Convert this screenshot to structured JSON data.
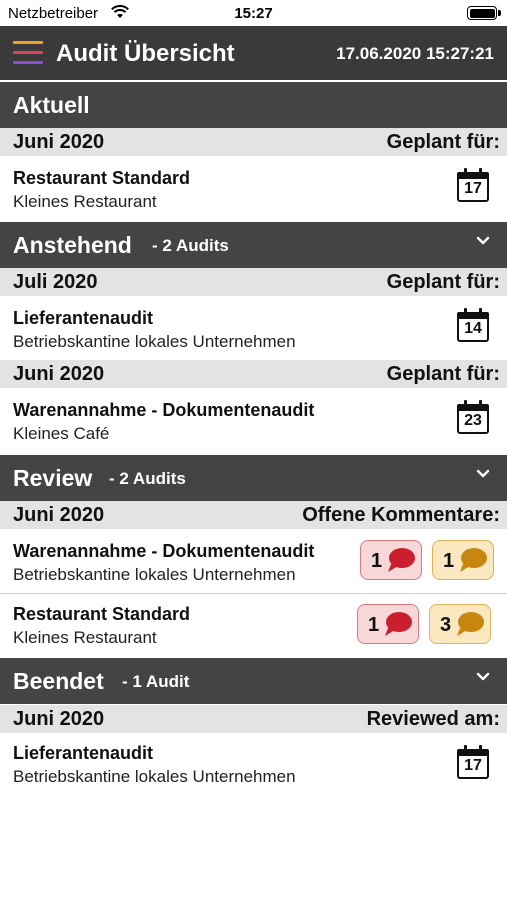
{
  "status_bar": {
    "carrier": "Netzbetreiber",
    "time": "15:27"
  },
  "nav": {
    "title": "Audit Übersicht",
    "datetime": "17.06.2020 15:27:21"
  },
  "sections": {
    "aktuell": {
      "title": "Aktuell",
      "month": "Juni 2020",
      "right_label": "Geplant für:",
      "item": {
        "title": "Restaurant Standard",
        "subtitle": "Kleines Restaurant",
        "day": "17"
      }
    },
    "anstehend": {
      "title": "Anstehend",
      "count": "- 2 Audits",
      "groups": [
        {
          "month": "Juli 2020",
          "right_label": "Geplant für:",
          "item": {
            "title": "Lieferantenaudit",
            "subtitle": "Betriebskantine lokales Unternehmen",
            "day": "14"
          }
        },
        {
          "month": "Juni 2020",
          "right_label": "Geplant für:",
          "item": {
            "title": "Warenannahme - Dokumentenaudit",
            "subtitle": "Kleines Café",
            "day": "23"
          }
        }
      ]
    },
    "review": {
      "title": "Review",
      "count": "- 2 Audits",
      "month": "Juni 2020",
      "right_label": "Offene Kommentare:",
      "items": [
        {
          "title": "Warenannahme - Dokumentenaudit",
          "subtitle": "Betriebskantine lokales Unternehmen",
          "red_count": "1",
          "yellow_count": "1"
        },
        {
          "title": "Restaurant Standard",
          "subtitle": "Kleines Restaurant",
          "red_count": "1",
          "yellow_count": "3"
        }
      ]
    },
    "beendet": {
      "title": "Beendet",
      "count": "- 1 Audit",
      "month": "Juni 2020",
      "right_label": "Reviewed am:",
      "item": {
        "title": "Lieferantenaudit",
        "subtitle": "Betriebskantine lokales Unternehmen",
        "day": "17"
      }
    }
  },
  "icons": {
    "menu": "hamburger-menu-icon",
    "calendar": "calendar-icon",
    "chevron": "chevron-down-icon",
    "comment": "speech-bubble-icon"
  },
  "colors": {
    "navbar": "#3a3a3a",
    "section_header": "#444444",
    "month_header": "#e3e3e3",
    "badge_red": "#f7d7d7",
    "badge_red_bubble": "#cc1f2e",
    "badge_yellow": "#fbe8c0",
    "badge_yellow_bubble": "#c7870f",
    "menu_lines": [
      "#f0a020",
      "#e0405a",
      "#8a4fd0"
    ]
  }
}
